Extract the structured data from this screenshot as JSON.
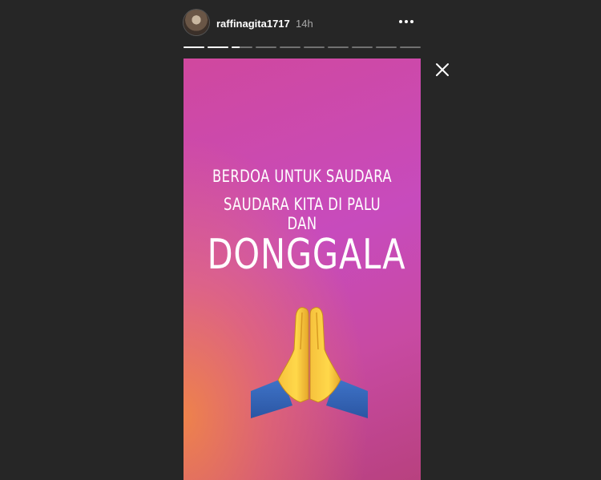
{
  "header": {
    "username": "raffinagita1717",
    "time": "14h"
  },
  "progress": {
    "segments": 10,
    "current_index": 2,
    "current_fraction": 0.4
  },
  "story": {
    "line1": "BERDOA UNTUK SAUDARA",
    "line2": "SAUDARA KITA DI PALU DAN",
    "big_text": "DONGGALA",
    "emoji": "folded-hands-icon"
  },
  "icons": {
    "more": "more-options-icon",
    "close": "close-icon"
  },
  "colors": {
    "background": "#262626",
    "gradient_top": "#d0489e",
    "gradient_mid": "#c74bbd",
    "gradient_bottom_left": "#f48c3c",
    "text": "#ffffff"
  }
}
